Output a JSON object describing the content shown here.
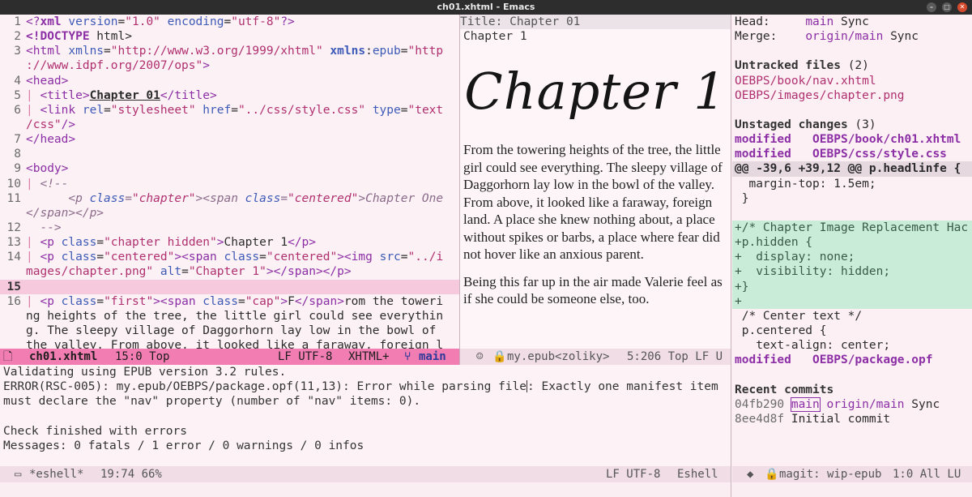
{
  "window": {
    "title": "ch01.xhtml - Emacs"
  },
  "code": {
    "lines": [
      {
        "n": "1",
        "html": "<span class=\"tag\">&lt;?</span><span class=\"tagb\">xml</span> <span class=\"attr\">version</span>=<span class=\"str\">\"1.0\"</span> <span class=\"attr\">encoding</span>=<span class=\"str\">\"utf-8\"</span><span class=\"tag\">?&gt;</span>"
      },
      {
        "n": "2",
        "html": "<span class=\"tagb\">&lt;!DOCTYPE</span> html&gt;"
      },
      {
        "n": "3",
        "html": "<span class=\"tag\">&lt;html</span> <span class=\"attr\">xmlns</span>=<span class=\"str\">\"http://www.w3.org/1999/xhtml\"</span> <span class=\"attr bold\">xmlns</span>:<span class=\"attr\">epub</span>=<span class=\"str\">\"http</span>"
      },
      {
        "n": "",
        "html": "<span class=\"str\">://www.idpf.org/2007/ops\"</span><span class=\"tag\">&gt;</span>"
      },
      {
        "n": "4",
        "html": "<span class=\"tag\">&lt;head&gt;</span>"
      },
      {
        "n": "5",
        "html": "<span class=\"indent-bar\">|</span> <span class=\"tag\">&lt;title&gt;</span><span class=\"bold\" style=\"text-decoration:underline\">Chapter 01</span><span class=\"tag\">&lt;/title&gt;</span>"
      },
      {
        "n": "6",
        "html": "<span class=\"indent-bar\">|</span> <span class=\"tag\">&lt;link</span> <span class=\"attr\">rel</span>=<span class=\"str\">\"stylesheet\"</span> <span class=\"attr\">href</span>=<span class=\"str\">\"../css/style.css\"</span> <span class=\"attr\">type</span>=<span class=\"str\">\"text</span>"
      },
      {
        "n": "",
        "html": "<span class=\"str\">/css\"</span><span class=\"tag\">/&gt;</span>"
      },
      {
        "n": "7",
        "html": "<span class=\"tag\">&lt;/head&gt;</span>"
      },
      {
        "n": "8",
        "html": ""
      },
      {
        "n": "9",
        "html": "<span class=\"tag\">&lt;body&gt;</span>"
      },
      {
        "n": "10",
        "html": "<span class=\"indent-bar\">|</span> <span class=\"cmt\">&lt;!--</span>"
      },
      {
        "n": "11",
        "html": "<span class=\"cmt\">      &lt;p </span><span class=\"cmt\" style=\"color:#3d5ab7\">class</span><span class=\"cmt\">=</span><span class=\"cmt\" style=\"color:#b0306f\">\"chapter\"</span><span class=\"cmt\">&gt;&lt;span </span><span class=\"cmt\" style=\"color:#3d5ab7\">class</span><span class=\"cmt\">=</span><span class=\"cmt\" style=\"color:#b0306f\">\"centered\"</span><span class=\"cmt\">&gt;Chapter One</span>"
      },
      {
        "n": "",
        "html": "<span class=\"cmt\">&lt;/span&gt;&lt;/p&gt;</span>"
      },
      {
        "n": "12",
        "html": "<span class=\"cmt\">  --&gt;</span>"
      },
      {
        "n": "13",
        "html": "<span class=\"indent-bar\">|</span> <span class=\"tag\">&lt;p</span> <span class=\"attr\">class</span>=<span class=\"str\">\"chapter hidden\"</span><span class=\"tag\">&gt;</span>Chapter 1<span class=\"tag\">&lt;/p&gt;</span>"
      },
      {
        "n": "14",
        "html": "<span class=\"indent-bar\">|</span> <span class=\"tag\">&lt;p</span> <span class=\"attr\">class</span>=<span class=\"str\">\"centered\"</span><span class=\"tag\">&gt;&lt;span</span> <span class=\"attr\">class</span>=<span class=\"str\">\"centered\"</span><span class=\"tag\">&gt;&lt;img</span> <span class=\"attr\">src</span>=<span class=\"str\">\"../i</span>"
      },
      {
        "n": "",
        "html": "<span class=\"str\">mages/chapter.png\"</span> <span class=\"attr\">alt</span>=<span class=\"str\">\"Chapter 1\"</span><span class=\"tag\">&gt;&lt;/span&gt;&lt;/p&gt;</span>"
      },
      {
        "n": "15",
        "html": "",
        "current": true
      },
      {
        "n": "16",
        "html": "<span class=\"indent-bar\">|</span> <span class=\"tag\">&lt;p</span> <span class=\"attr\">class</span>=<span class=\"str\">\"first\"</span><span class=\"tag\">&gt;&lt;span</span> <span class=\"attr\">class</span>=<span class=\"str\">\"cap\"</span><span class=\"tag\">&gt;</span>F<span class=\"tag\">&lt;/span&gt;</span>rom the toweri"
      },
      {
        "n": "",
        "html": "ng heights of the tree, the little girl could see everythin"
      },
      {
        "n": "",
        "html": "g. The sleepy village of Daggorhorn lay low in the bowl of "
      },
      {
        "n": "",
        "html": "the valley. From above, it looked like a faraway, foreign l"
      }
    ],
    "modeline": {
      "file_icon": "document-icon",
      "filename": "ch01.xhtml",
      "position": "15:0 Top",
      "encoding": "LF UTF-8",
      "mode": "XHTML+",
      "vc_icon": "git-branch-icon",
      "branch": "main"
    }
  },
  "preview": {
    "title_bar": "Title: Chapter 01",
    "heading": "Chapter 1",
    "chapter_image_alt": "Chapter 1",
    "paragraphs": [
      "From the towering heights of the tree, the little girl could see everything. The sleepy village of Daggorhorn lay low in the bowl of the valley. From above, it looked like a faraway, foreign land. A place she knew nothing about, a place without spikes or barbs, a place where fear did not hover like an anxious parent.",
      "Being this far up in the air made Valerie feel as if she could be someone else, too."
    ],
    "modeline": {
      "icon": "emoji-face-icon",
      "lock_icon": "lock-icon",
      "buffer": "my.epub<zoliky>",
      "position": "5:206 Top LF U"
    }
  },
  "magit": {
    "head_label": "Head:",
    "head_branch": "main",
    "head_msg": "Sync",
    "merge_label": "Merge:",
    "merge_branch": "origin/main",
    "merge_msg": "Sync",
    "untracked_title": "Untracked files",
    "untracked_count": "(2)",
    "untracked": [
      "OEBPS/book/nav.xhtml",
      "OEBPS/images/chapter.png"
    ],
    "unstaged_title": "Unstaged changes",
    "unstaged_count": "(3)",
    "unstaged": [
      {
        "status": "modified",
        "file": "OEBPS/book/ch01.xhtml"
      },
      {
        "status": "modified",
        "file": "OEBPS/css/style.css"
      }
    ],
    "hunk_header": "@@ -39,6 +39,12 @@ p.headlinfe {",
    "diff_context_1": [
      " margin-top: 1.5em;",
      "}"
    ],
    "diff_added": [
      "+/* Chapter Image Replacement Hac",
      "+p.hidden {",
      "+  display: none;",
      "+  visibility: hidden;",
      "+}",
      "+"
    ],
    "diff_context_2": [
      " /* Center text */",
      " p.centered {",
      "   text-align: center;"
    ],
    "unstaged_last": {
      "status": "modified",
      "file": "OEBPS/package.opf"
    },
    "recent_title": "Recent commits",
    "commits": [
      {
        "hash": "04fb290",
        "branch": "main",
        "remote": "origin/main",
        "msg": "Sync"
      },
      {
        "hash": "8ee4d8f",
        "msg": "Initial commit"
      }
    ],
    "modeline": {
      "icon": "git-icon",
      "lock_icon": "lock-icon",
      "buffer": "magit: wip-epub",
      "position": "1:0 All LU"
    }
  },
  "eshell": {
    "lines": [
      "Validating using EPUB version 3.2 rules.",
      "ERROR(RSC-005): my.epub/OEBPS/package.opf(11,13): Error while parsing file",
      ": Exactly one manifest item",
      "must declare the \"nav\" property (number of \"nav\" items: 0).",
      "",
      "Check finished with errors",
      "Messages: 0 fatals / 1 error / 0 warnings / 0 infos"
    ],
    "modeline": {
      "icon": "terminal-icon",
      "buffer": "*eshell*",
      "position": "19:74 66%",
      "encoding": "LF UTF-8",
      "mode": "Eshell"
    }
  }
}
